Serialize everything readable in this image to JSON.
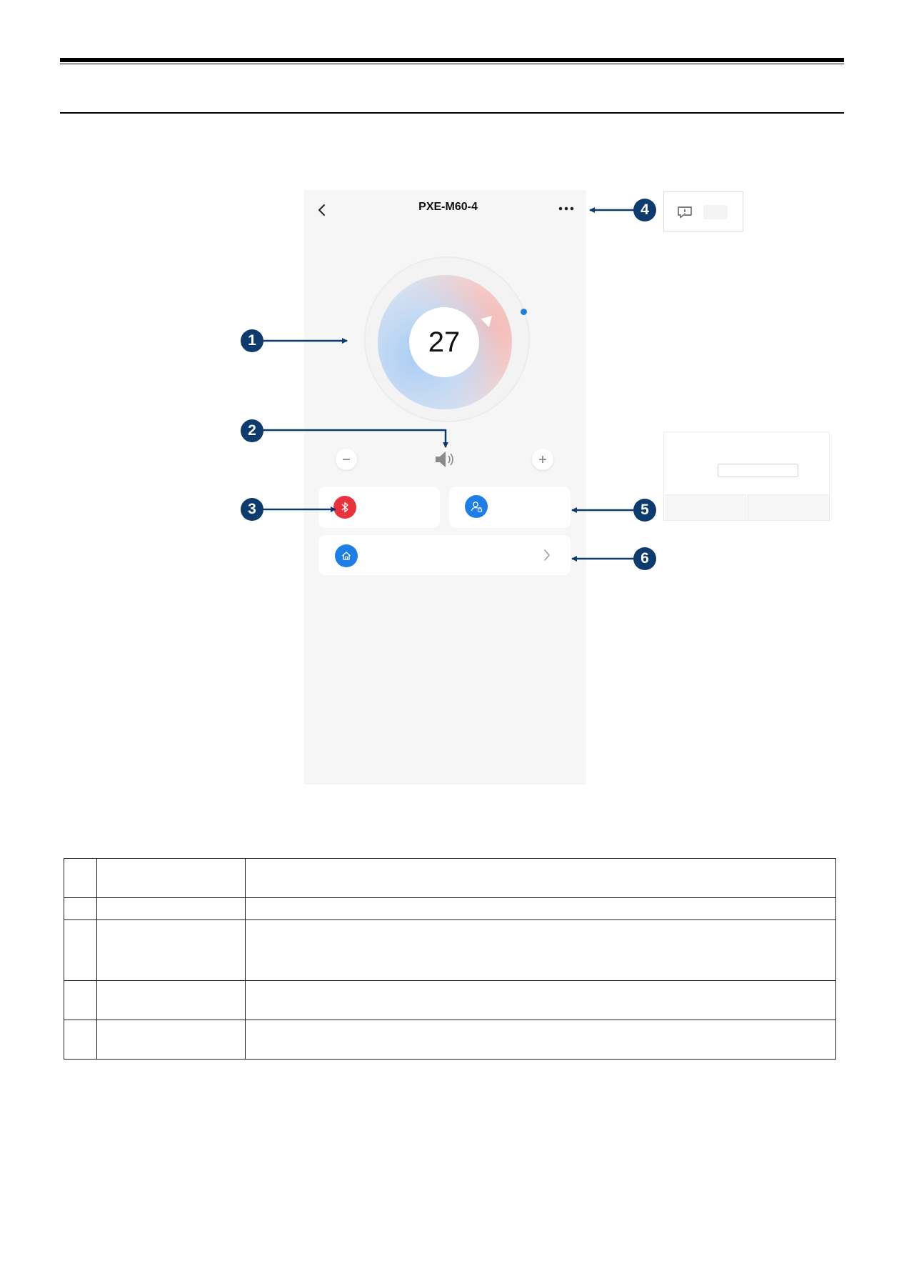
{
  "app": {
    "device_title": "PXE-M60-4",
    "temperature": "27",
    "icons": {
      "back": "chevron-left-icon",
      "more": "more-dots-icon",
      "volume": "speaker-icon",
      "decrease": "minus-icon",
      "increase": "plus-icon",
      "bluetooth": "bluetooth-icon",
      "user": "user-lock-icon",
      "home": "home-icon",
      "chevron": "chevron-right-icon",
      "feedback": "message-alert-icon"
    },
    "colors": {
      "accent_blue": "#1f7ee6",
      "bluetooth_red": "#e8333c",
      "badge_navy": "#0d3b6e",
      "dial_indicator": "#1a7fe0"
    }
  },
  "callouts": [
    "1",
    "2",
    "3",
    "4",
    "5",
    "6"
  ],
  "table": {
    "rows": [
      {
        "num": "",
        "name": "",
        "desc": ""
      },
      {
        "num": "",
        "name": "",
        "desc": ""
      },
      {
        "num": "",
        "name": "",
        "desc": ""
      },
      {
        "num": "",
        "name": "",
        "desc": ""
      },
      {
        "num": "",
        "name": "",
        "desc": ""
      }
    ]
  }
}
